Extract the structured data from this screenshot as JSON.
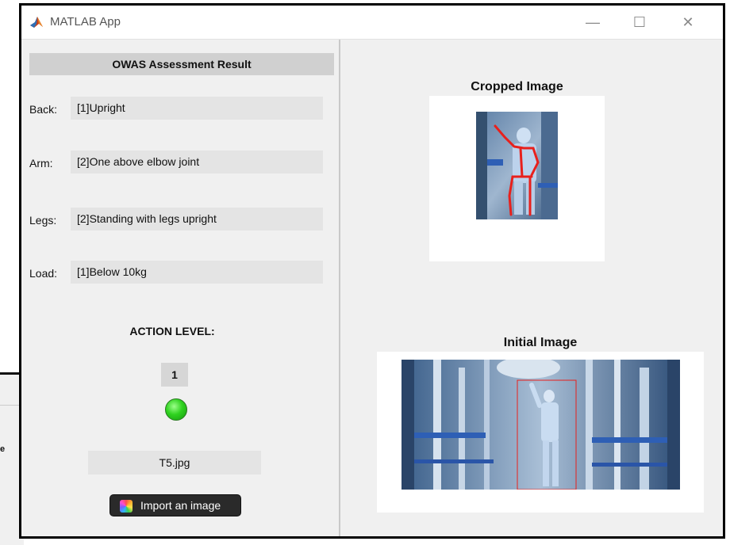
{
  "window": {
    "title": "MATLAB App",
    "minimize_glyph": "—",
    "maximize_glyph": "☐",
    "close_glyph": "✕"
  },
  "background_window": {
    "partial_text": "e"
  },
  "result": {
    "header": "OWAS Assessment Result",
    "fields": [
      {
        "label": "Back:",
        "value": "[1]Upright"
      },
      {
        "label": "Arm:",
        "value": "[2]One above elbow joint"
      },
      {
        "label": "Legs:",
        "value": "[2]Standing with legs upright"
      },
      {
        "label": "Load:",
        "value": "[1]Below 10kg"
      }
    ]
  },
  "action": {
    "title": "ACTION LEVEL:",
    "value": "1",
    "lamp_color": "#2fd21f"
  },
  "file": {
    "name": "T5.jpg"
  },
  "import_button": {
    "label": "Import an image"
  },
  "images": {
    "cropped_title": "Cropped Image",
    "initial_title": "Initial Image"
  },
  "colors": {
    "panel_bg": "#f0f0f0",
    "field_bg": "#e4e4e4",
    "header_bg": "#d0d0d0",
    "skeleton": "#e8201c",
    "button_bg": "#2a2a2a"
  }
}
